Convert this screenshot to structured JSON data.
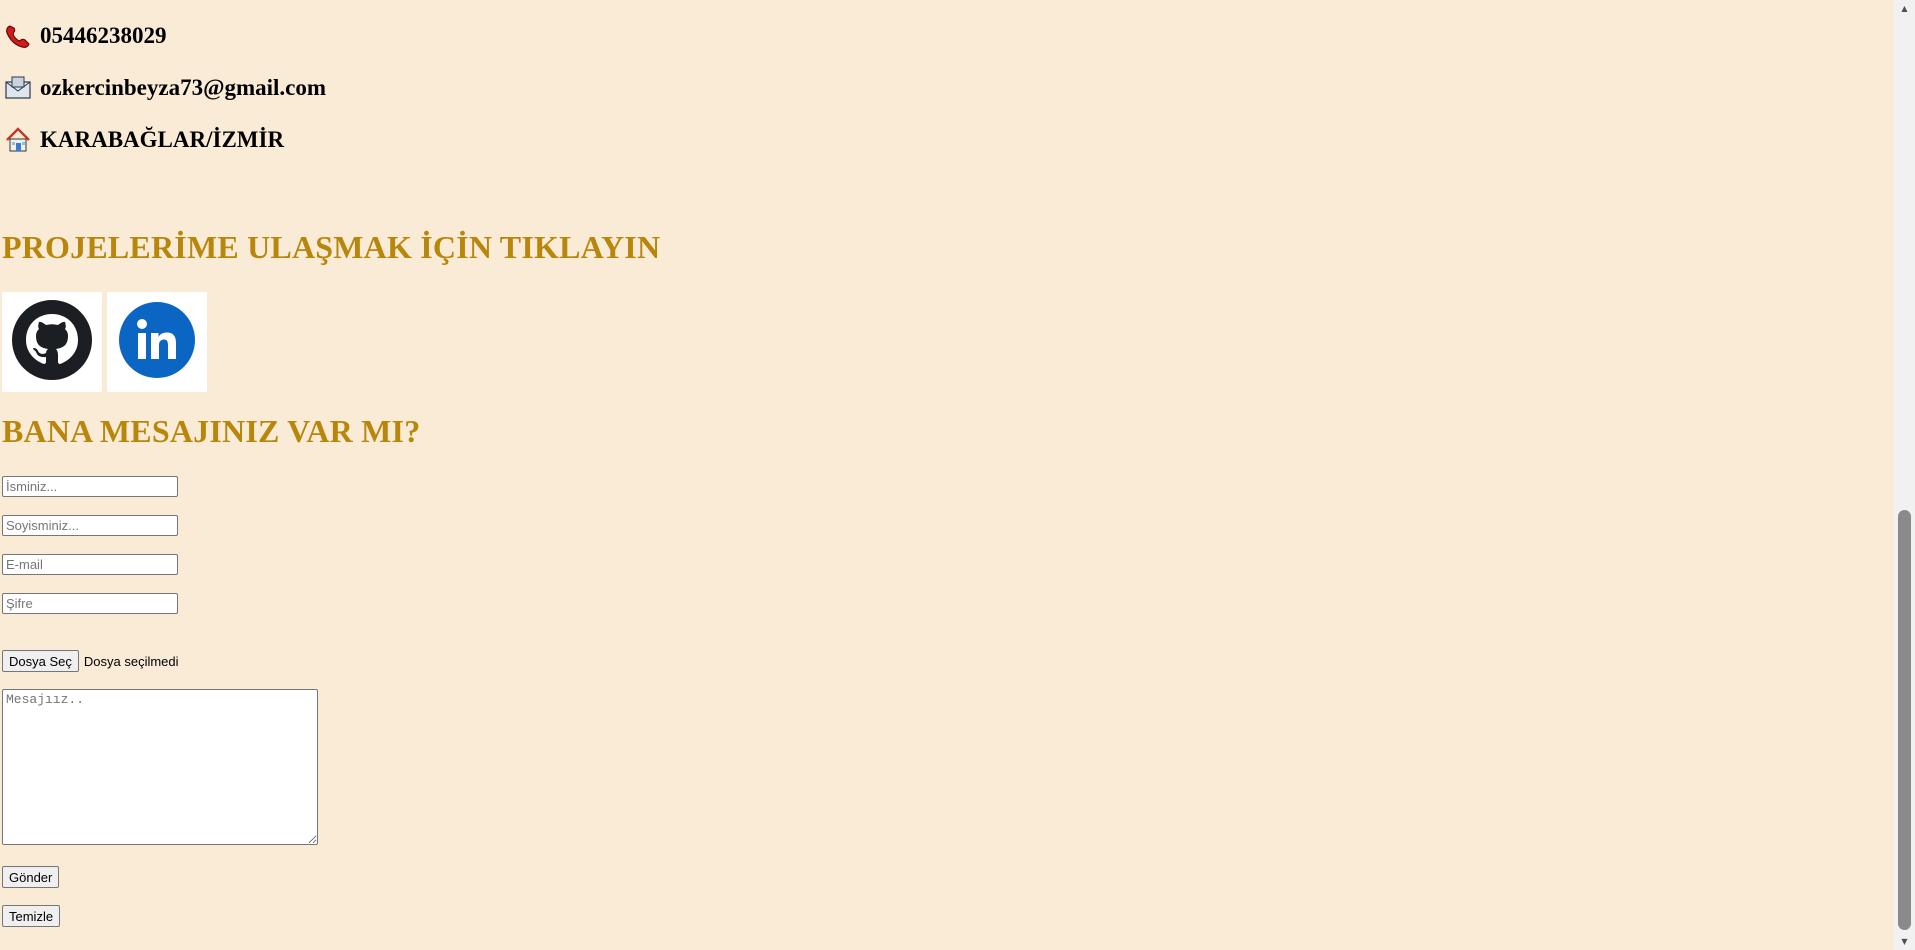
{
  "contact": {
    "phone": "05446238029",
    "email": "ozkercinbeyza73@gmail.com",
    "address": "KARABAĞLAR/İZMİR",
    "icons": {
      "phone": "telephone-icon",
      "email": "envelope-icon",
      "address": "house-icon"
    }
  },
  "projects": {
    "heading": "PROJELERİME ULAŞMAK İÇİN TIKLAYIN",
    "links": [
      {
        "icon": "github-icon",
        "color": "#1b1f23"
      },
      {
        "icon": "linkedin-icon",
        "color": "#0a66c2"
      }
    ]
  },
  "form": {
    "heading": "BANA MESAJINIZ VAR MI?",
    "name_placeholder": "İsminiz...",
    "surname_placeholder": "Soyisminiz...",
    "email_placeholder": "E-mail",
    "password_placeholder": "Şifre",
    "file_button_label": "Dosya Seç",
    "file_status": "Dosya seçilmedi",
    "message_placeholder": "Mesajıız..",
    "submit_label": "Gönder",
    "reset_label": "Temizle"
  },
  "colors": {
    "background": "#faebd7",
    "heading": "#b8860b"
  }
}
